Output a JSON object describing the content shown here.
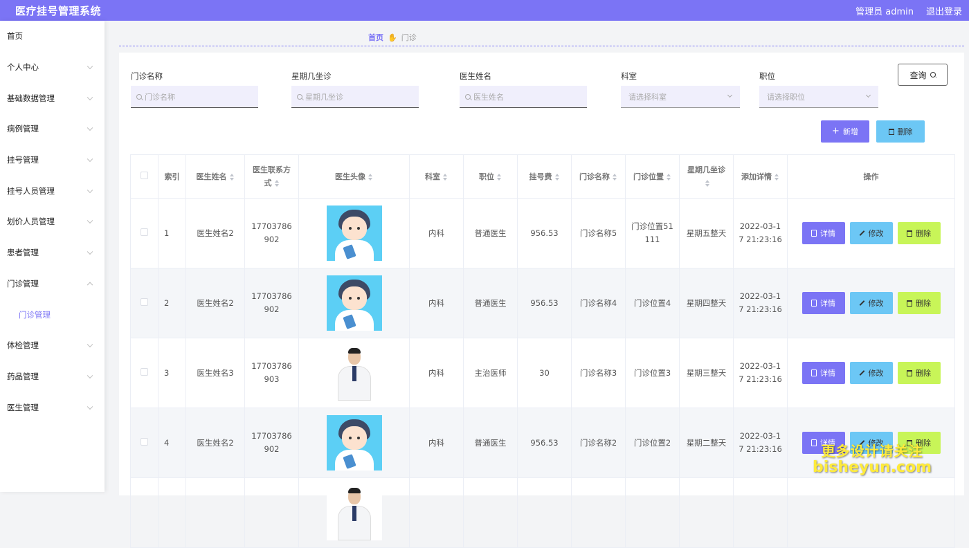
{
  "app": {
    "title": "医疗挂号管理系统",
    "user": "管理员 admin",
    "logout": "退出登录"
  },
  "sidebar": {
    "items": [
      {
        "label": "首页",
        "chevron": "none"
      },
      {
        "label": "个人中心",
        "chevron": "down"
      },
      {
        "label": "基础数据管理",
        "chevron": "down"
      },
      {
        "label": "病例管理",
        "chevron": "down"
      },
      {
        "label": "挂号管理",
        "chevron": "down"
      },
      {
        "label": "挂号人员管理",
        "chevron": "down"
      },
      {
        "label": "划价人员管理",
        "chevron": "down"
      },
      {
        "label": "患者管理",
        "chevron": "down"
      },
      {
        "label": "门诊管理",
        "chevron": "up"
      },
      {
        "label": "门诊管理",
        "chevron": "sub"
      },
      {
        "label": "体检管理",
        "chevron": "down"
      },
      {
        "label": "药品管理",
        "chevron": "down"
      },
      {
        "label": "医生管理",
        "chevron": "down"
      }
    ]
  },
  "breadcrumb": {
    "home": "首页",
    "separator_icon": "hand-icon",
    "current": "门诊"
  },
  "filters": {
    "name_label": "门诊名称",
    "name_placeholder": "门诊名称",
    "weekday_label": "星期几坐诊",
    "weekday_placeholder": "星期几坐诊",
    "doctor_label": "医生姓名",
    "doctor_placeholder": "医生姓名",
    "dept_label": "科室",
    "dept_placeholder": "请选择科室",
    "title_label": "职位",
    "title_placeholder": "请选择职位",
    "query_button": "查询"
  },
  "actions": {
    "add": "新增",
    "delete": "删除"
  },
  "table": {
    "headers": {
      "index": "索引",
      "doctor": "医生姓名",
      "phone": "医生联系方式",
      "avatar": "医生头像",
      "dept": "科室",
      "title": "职位",
      "fee": "挂号费",
      "clinic": "门诊名称",
      "location": "门诊位置",
      "weekday": "星期几坐诊",
      "added": "添加详情",
      "ops": "操作"
    },
    "row_actions": {
      "detail": "详情",
      "edit": "修改",
      "delete": "删除"
    },
    "rows": [
      {
        "index": "1",
        "doctor": "医生姓名2",
        "phone": "17703786902",
        "avatar": "cartoon",
        "dept": "内科",
        "title": "普通医生",
        "fee": "956.53",
        "clinic": "门诊名称5",
        "location": "门诊位置51111",
        "weekday": "星期五整天",
        "added": "2022-03-17 21:23:16"
      },
      {
        "index": "2",
        "doctor": "医生姓名2",
        "phone": "17703786902",
        "avatar": "cartoon",
        "dept": "内科",
        "title": "普通医生",
        "fee": "956.53",
        "clinic": "门诊名称4",
        "location": "门诊位置4",
        "weekday": "星期四整天",
        "added": "2022-03-17 21:23:16"
      },
      {
        "index": "3",
        "doctor": "医生姓名3",
        "phone": "17703786903",
        "avatar": "photo",
        "dept": "内科",
        "title": "主治医师",
        "fee": "30",
        "clinic": "门诊名称3",
        "location": "门诊位置3",
        "weekday": "星期三整天",
        "added": "2022-03-17 21:23:16"
      },
      {
        "index": "4",
        "doctor": "医生姓名2",
        "phone": "17703786902",
        "avatar": "cartoon",
        "dept": "内科",
        "title": "普通医生",
        "fee": "956.53",
        "clinic": "门诊名称2",
        "location": "门诊位置2",
        "weekday": "星期二整天",
        "added": "2022-03-17 21:23:16"
      },
      {
        "index": "",
        "doctor": "",
        "phone": "",
        "avatar": "photo",
        "dept": "",
        "title": "",
        "fee": "",
        "clinic": "",
        "location": "",
        "weekday": "",
        "added": ""
      }
    ]
  },
  "watermark": {
    "line1": "更多设计请关注",
    "line2": "bisheyun.com"
  }
}
